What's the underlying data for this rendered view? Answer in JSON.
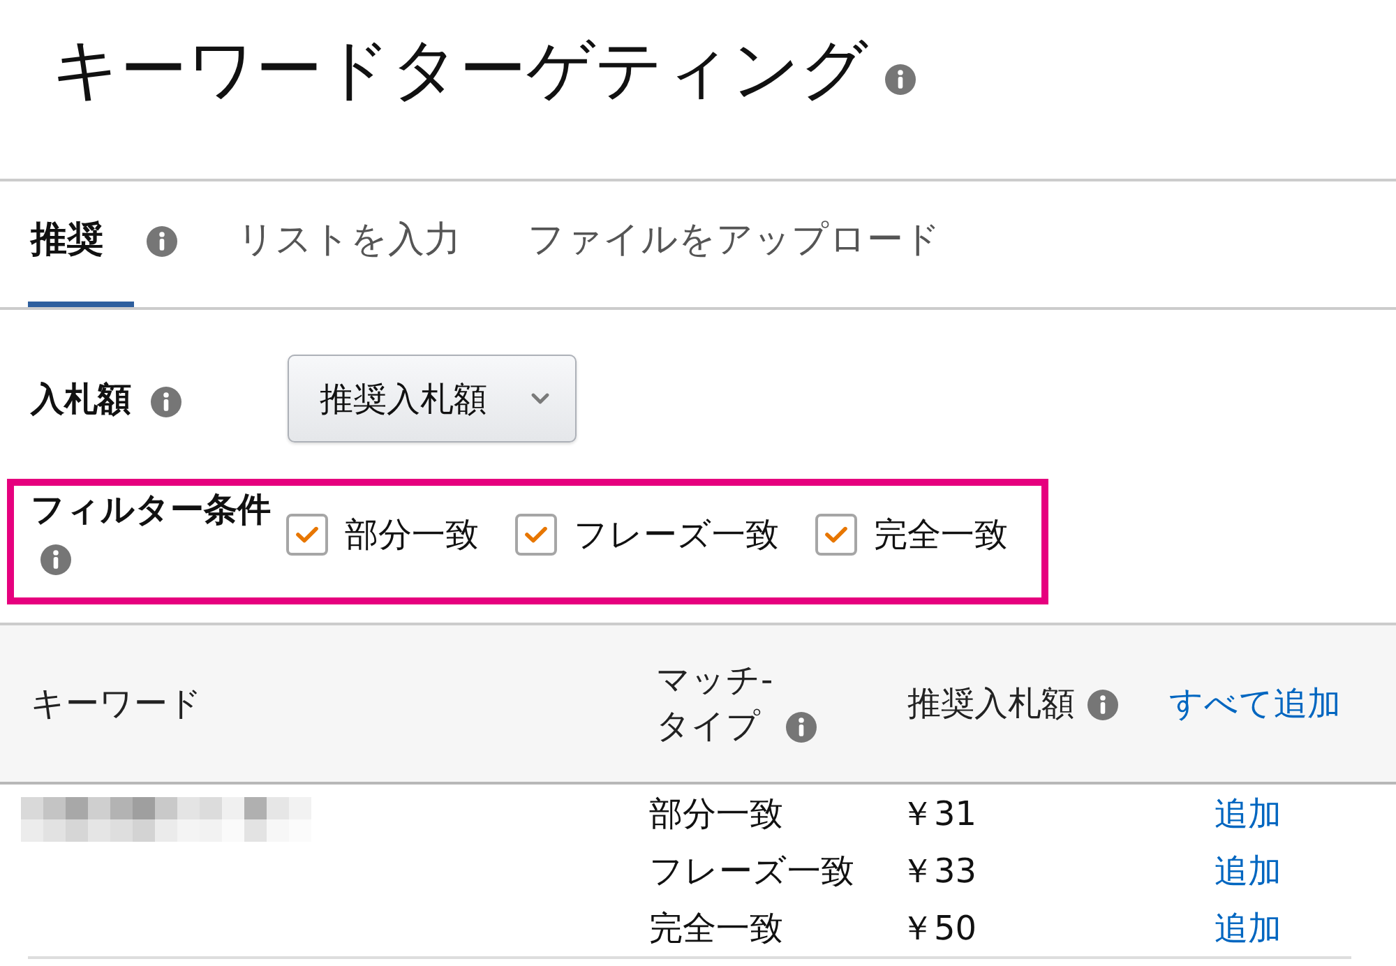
{
  "page": {
    "title": "キーワードターゲティング"
  },
  "tabs": [
    {
      "label": "推奨",
      "selected": true,
      "info_icon": true
    },
    {
      "label": "リストを入力",
      "selected": false,
      "info_icon": false
    },
    {
      "label": "ファイルをアップロード",
      "selected": false,
      "info_icon": false
    }
  ],
  "bid": {
    "label": "入札額",
    "dropdown": "推奨入札額"
  },
  "filter": {
    "label": "フィルター条件",
    "highlighted": true,
    "options": [
      {
        "label": "部分一致",
        "checked": true
      },
      {
        "label": "フレーズ一致",
        "checked": true
      },
      {
        "label": "完全一致",
        "checked": true
      }
    ]
  },
  "table": {
    "columns": [
      {
        "label": "キーワード",
        "info_icon": false
      },
      {
        "label": "マッチ-\nタイプ",
        "info_icon": true
      },
      {
        "label": "推奨入札額",
        "info_icon": true
      }
    ],
    "add_all": "すべて追加",
    "rows": [
      {
        "match_type": "部分一致",
        "bid": "￥31",
        "action": "追加"
      },
      {
        "match_type": "フレーズ一致",
        "bid": "￥33",
        "action": "追加"
      },
      {
        "match_type": "完全一致",
        "bid": "￥50",
        "action": "追加"
      }
    ]
  }
}
